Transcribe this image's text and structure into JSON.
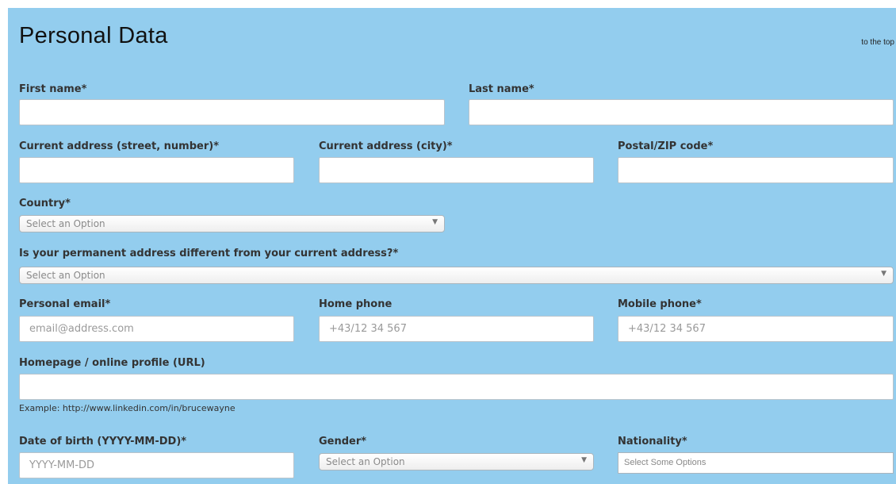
{
  "section": {
    "title": "Personal Data",
    "to_top": "to the top"
  },
  "fields": {
    "first_name": {
      "label": "First name*",
      "value": ""
    },
    "last_name": {
      "label": "Last name*",
      "value": ""
    },
    "street": {
      "label": "Current address (street, number)*",
      "value": ""
    },
    "city": {
      "label": "Current address (city)*",
      "value": ""
    },
    "zip": {
      "label": "Postal/ZIP code*",
      "value": ""
    },
    "country": {
      "label": "Country*",
      "selected": "Select an Option"
    },
    "permanent_diff": {
      "label": "Is your permanent address different from your current address?*",
      "selected": "Select an Option"
    },
    "email": {
      "label": "Personal email*",
      "placeholder": "email@address.com",
      "value": ""
    },
    "home_phone": {
      "label": "Home phone",
      "placeholder": "+43/12 34 567",
      "value": ""
    },
    "mobile_phone": {
      "label": "Mobile phone*",
      "placeholder": "+43/12 34 567",
      "value": ""
    },
    "homepage": {
      "label": "Homepage / online profile (URL)",
      "value": "",
      "hint": "Example: http://www.linkedin.com/in/brucewayne"
    },
    "dob": {
      "label": "Date of birth (YYYY-MM-DD)*",
      "placeholder": "YYYY-MM-DD",
      "value": ""
    },
    "gender": {
      "label": "Gender*",
      "selected": "Select an Option"
    },
    "nationality": {
      "label": "Nationality*",
      "placeholder": "Select Some Options"
    }
  },
  "icons": {
    "dropdown": "chevron-down-icon"
  }
}
